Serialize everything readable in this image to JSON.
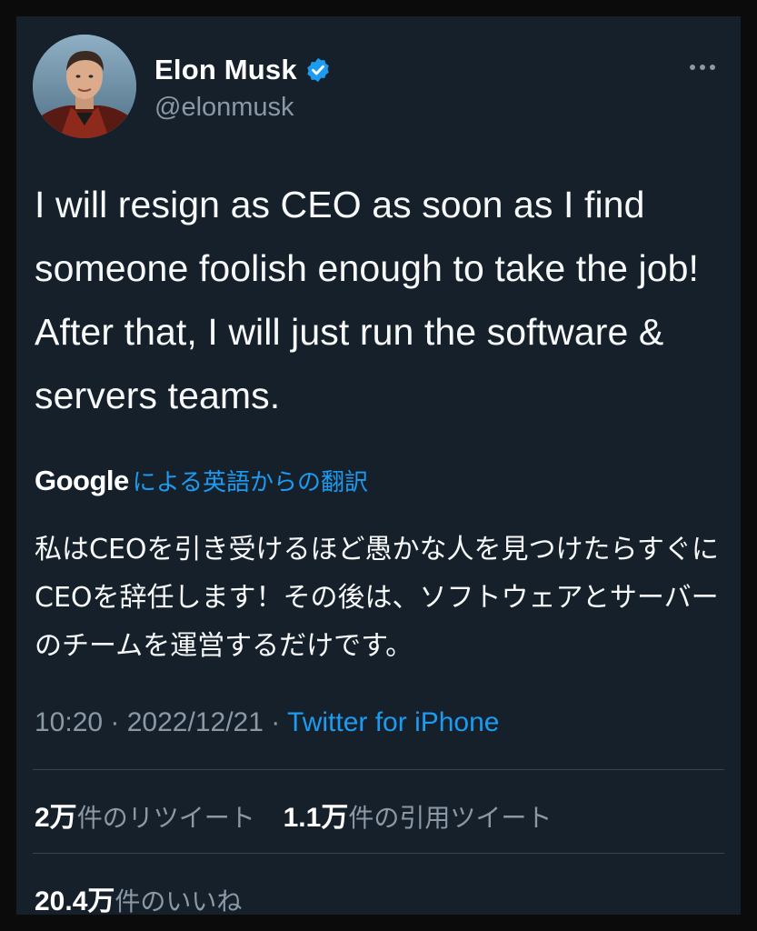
{
  "user": {
    "display_name": "Elon Musk",
    "handle": "@elonmusk",
    "verified": true,
    "verified_color": "#1d9bf0"
  },
  "tweet": {
    "text": "I will resign as CEO as soon as I find someone foolish enough to take the job! After that, I will just run the software & servers teams."
  },
  "translation": {
    "provider": "Google",
    "label_suffix": "による英語からの翻訳",
    "text": "私はCEOを引き受けるほど愚かな人を見つけたらすぐにCEOを辞任します！その後は、ソフトウェアとサーバーのチームを運営するだけです。"
  },
  "meta": {
    "time": "10:20",
    "separator": "·",
    "date": "2022/12/21",
    "source": "Twitter for iPhone"
  },
  "stats": {
    "retweets": {
      "count": "2万",
      "label": "件のリツイート"
    },
    "quotes": {
      "count": "1.1万",
      "label": "件の引用ツイート"
    },
    "likes": {
      "count": "20.4万",
      "label": "件のいいね"
    }
  },
  "icons": {
    "verified": "verified-badge-icon",
    "more": "more-options-icon"
  },
  "colors": {
    "background": "#15202b",
    "accent": "#1d9bf0",
    "secondary_text": "#8b98a5",
    "divider": "#38444d"
  }
}
